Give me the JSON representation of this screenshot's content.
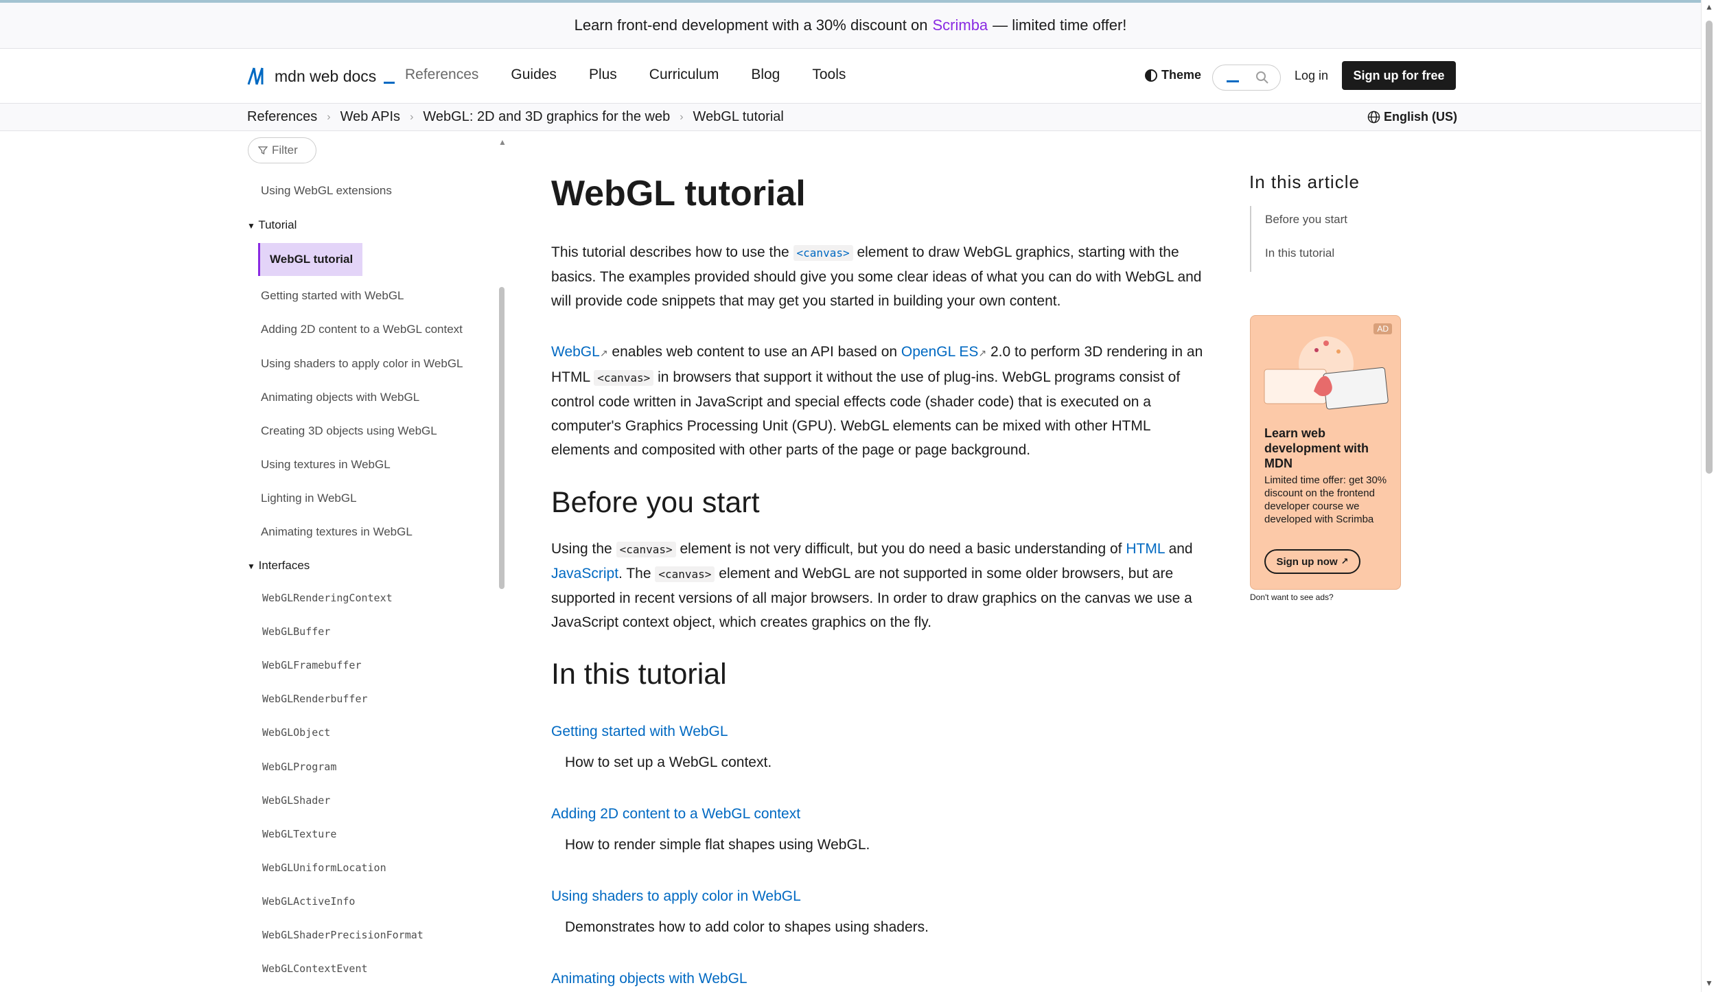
{
  "banner": {
    "prefix": "Learn front-end development with a 30% discount on",
    "link": "Scrimba",
    "suffix": "— limited time offer!"
  },
  "header": {
    "logo_text": "mdn web docs",
    "nav": [
      "References",
      "Guides",
      "Plus",
      "Curriculum",
      "Blog",
      "Tools"
    ],
    "theme_label": "Theme",
    "login_label": "Log in",
    "signup_label": "Sign up for free",
    "icons": {
      "logo": "mdn-logo-icon",
      "theme": "theme-icon",
      "search": "search-icon"
    }
  },
  "breadcrumb": {
    "items": [
      "References",
      "Web APIs",
      "WebGL: 2D and 3D graphics for the web",
      "WebGL tutorial"
    ],
    "language": "English (US)"
  },
  "sidebar": {
    "filter_label": "Filter",
    "items_top": [
      "Using WebGL extensions"
    ],
    "group_tutorial": "Tutorial",
    "active_item": "WebGL tutorial",
    "tutorial_items": [
      "Getting started with WebGL",
      "Adding 2D content to a WebGL context",
      "Using shaders to apply color in WebGL",
      "Animating objects with WebGL",
      "Creating 3D objects using WebGL",
      "Using textures in WebGL",
      "Lighting in WebGL",
      "Animating textures in WebGL"
    ],
    "group_interfaces": "Interfaces",
    "interface_items": [
      "WebGLRenderingContext",
      "WebGLBuffer",
      "WebGLFramebuffer",
      "WebGLRenderbuffer",
      "WebGLObject",
      "WebGLProgram",
      "WebGLShader",
      "WebGLTexture",
      "WebGLUniformLocation",
      "WebGLActiveInfo",
      "WebGLShaderPrecisionFormat",
      "WebGLContextEvent"
    ]
  },
  "main": {
    "title": "WebGL tutorial",
    "intro": {
      "a": "This tutorial describes how to use the",
      "code": "<canvas>",
      "b": "element to draw WebGL graphics, starting with the basics. The examples provided should give you some clear ideas of what you can do with WebGL and will provide code snippets that may get you started in building your own content."
    },
    "p2": {
      "link1": "WebGL",
      "a": "enables web content to use an API based on",
      "link2": "OpenGL ES",
      "b": "2.0 to perform 3D rendering in an HTML",
      "code": "<canvas>",
      "c": "in browsers that support it without the use of plug-ins. WebGL programs consist of control code written in JavaScript and special effects code (shader code) that is executed on a computer's Graphics Processing Unit (GPU). WebGL elements can be mixed with other HTML elements and composited with other parts of the page or page background."
    },
    "before_heading": "Before you start",
    "before": {
      "a": "Using the",
      "code1": "<canvas>",
      "b": "element is not very difficult, but you do need a basic understanding of",
      "link_html": "HTML",
      "c": "and",
      "link_js": "JavaScript",
      "d": ". The",
      "code2": "<canvas>",
      "e": "element and WebGL are not supported in some older browsers, but are supported in recent versions of all major browsers. In order to draw graphics on the canvas we use a JavaScript context object, which creates graphics on the fly."
    },
    "tutorial_heading": "In this tutorial",
    "tutorial_list": [
      {
        "link": "Getting started with WebGL",
        "desc": "How to set up a WebGL context."
      },
      {
        "link": "Adding 2D content to a WebGL context",
        "desc": "How to render simple flat shapes using WebGL."
      },
      {
        "link": "Using shaders to apply color in WebGL",
        "desc": "Demonstrates how to add color to shapes using shaders."
      },
      {
        "link": "Animating objects with WebGL",
        "desc": ""
      }
    ]
  },
  "toc": {
    "title": "In this article",
    "items": [
      "Before you start",
      "In this tutorial"
    ]
  },
  "ad": {
    "badge": "AD",
    "title": "Learn web development with MDN",
    "text": "Limited time offer: get 30% discount on the frontend developer course we developed with Scrimba",
    "button": "Sign up now",
    "note": "Don't want to see ads?"
  },
  "colors": {
    "accent": "#8a2be2",
    "link": "#0069c2",
    "ad_bg": "#fcc9a8"
  }
}
